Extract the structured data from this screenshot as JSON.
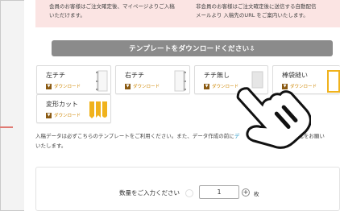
{
  "notice": {
    "left_text": "会員のお客様はご注文確定後、マイページよりご入稿",
    "left_text_cont": "いただけます。",
    "right_text": "非会員のお客様はご注文確定後に送信する自動配信",
    "right_text_cont": "メールより 入稿先のURL をご案内いたします。"
  },
  "download_bar": {
    "label": "テンプレートをダウンロードください⇩"
  },
  "templates": [
    {
      "label": "左チチ",
      "download": "ダウンロード",
      "badge": "▼"
    },
    {
      "label": "右チチ",
      "download": "ダウンロード",
      "badge": "▼"
    },
    {
      "label": "チチ無し",
      "download": "ダウンロード",
      "badge": "▼"
    },
    {
      "label": "棒袋縫い",
      "download": "ダウンロード",
      "badge": "▼"
    },
    {
      "label": "変形カット",
      "download": "ダウンロード",
      "badge": "▼"
    }
  ],
  "note": {
    "text_before": "入稿データは必ずこちらのテンプレートをご利用ください。また、データ作成の前に",
    "link": "デ",
    "text_after": "ご確認をお願い",
    "line2": "いたします。"
  },
  "quantity": {
    "label": "数量をご入力ください",
    "value": "1",
    "plus": "+",
    "unit": "枚"
  },
  "colors": {
    "notice_bg": "#fbe4e3",
    "bar_bg": "#8b8b8b",
    "accent_orange": "#f0b21c",
    "download_text": "#d08a0a",
    "link": "#2a9ac8"
  }
}
